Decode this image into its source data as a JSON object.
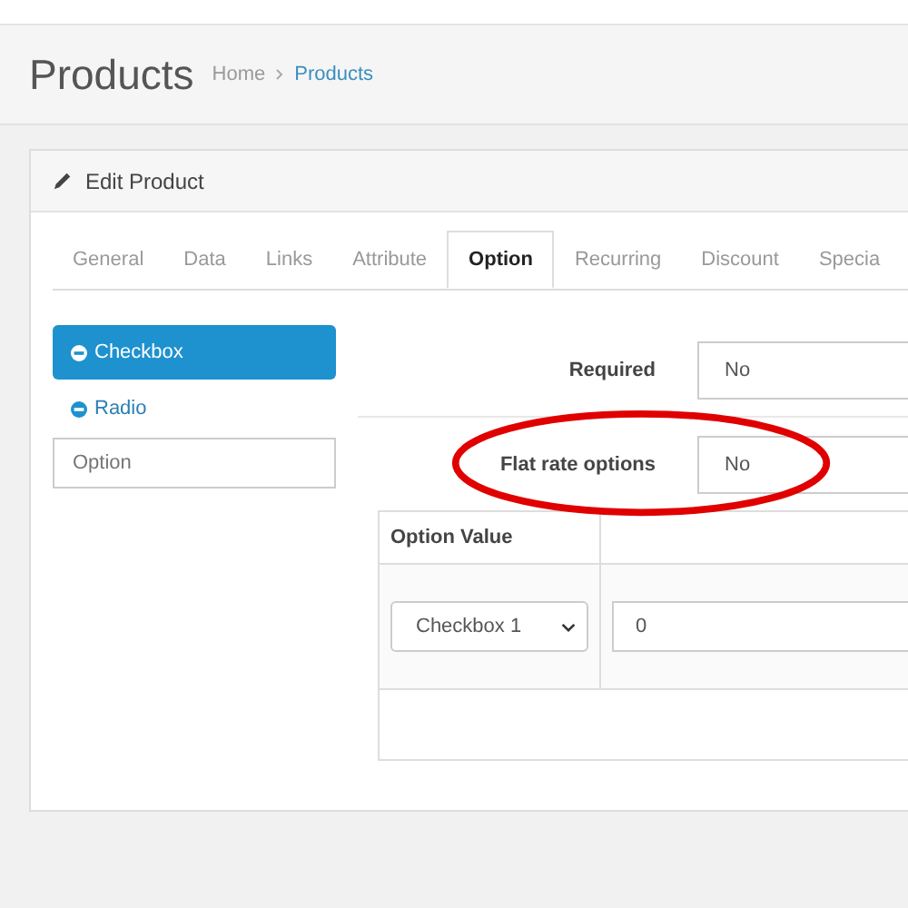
{
  "page_header": {
    "title": "Products",
    "breadcrumb": [
      {
        "label": "Home",
        "current": false
      },
      {
        "label": "Products",
        "current": true
      }
    ]
  },
  "panel": {
    "title": "Edit Product"
  },
  "tabs": [
    {
      "label": "General",
      "selected": false
    },
    {
      "label": "Data",
      "selected": false
    },
    {
      "label": "Links",
      "selected": false
    },
    {
      "label": "Attribute",
      "selected": false
    },
    {
      "label": "Option",
      "selected": true
    },
    {
      "label": "Recurring",
      "selected": false
    },
    {
      "label": "Discount",
      "selected": false
    },
    {
      "label": "Specia",
      "selected": false
    }
  ],
  "option_list": {
    "items": [
      {
        "label": "Checkbox",
        "selected": true
      },
      {
        "label": "Radio",
        "selected": false
      }
    ],
    "input": {
      "placeholder": "Option"
    }
  },
  "fields": [
    {
      "label": "Required",
      "value": "No",
      "highlighted": false
    },
    {
      "label": "Flat rate options",
      "value": "No",
      "highlighted": true
    }
  ],
  "option_values": {
    "columns": [
      "Option Value"
    ],
    "rows": [
      {
        "option_value": "Checkbox 1",
        "column_2": "0"
      }
    ]
  }
}
